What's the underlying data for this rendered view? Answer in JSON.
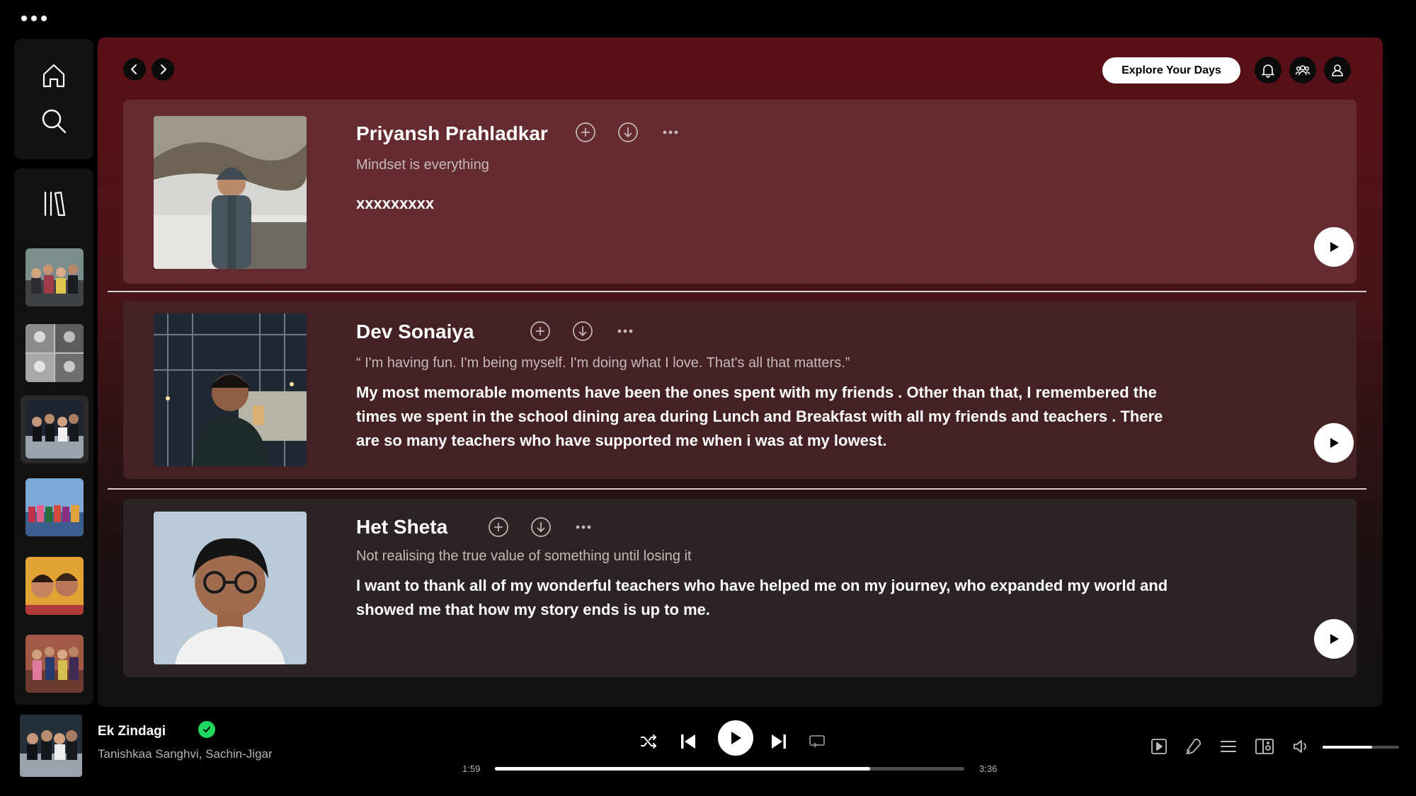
{
  "app": {
    "menu_icon": "ellipsis-icon"
  },
  "sidebar": {
    "nav": [
      {
        "name": "home",
        "icon": "home-icon"
      },
      {
        "name": "search",
        "icon": "search-icon"
      }
    ],
    "library_icon": "library-icon",
    "playlists": [
      {
        "name": "playlist-1"
      },
      {
        "name": "playlist-2"
      },
      {
        "name": "playlist-3",
        "active": true
      },
      {
        "name": "playlist-4"
      },
      {
        "name": "playlist-5"
      },
      {
        "name": "playlist-6"
      }
    ]
  },
  "header": {
    "back_icon": "chevron-left-icon",
    "forward_icon": "chevron-right-icon",
    "explore_label": "Explore Your Days",
    "icons": [
      "bell-icon",
      "friends-icon",
      "user-icon"
    ]
  },
  "cards": [
    {
      "name": "Priyansh Prahladkar",
      "tagline": "Mindset is everything",
      "body": "xxxxxxxxx"
    },
    {
      "name": "Dev Sonaiya",
      "tagline": "“ I'm having fun. I'm being myself. I'm doing what I love. That's all that matters.”",
      "body": "My most memorable moments have been the ones spent with my friends . Other than that, I remembered the times we spent in the school dining area during Lunch and Breakfast with all my friends and teachers . There are so many teachers who have supported me when i was at my lowest."
    },
    {
      "name": "Het Sheta",
      "tagline": "Not realising the true value of something until losing it",
      "body": "I want to thank all of my wonderful teachers who have helped me on my journey, who expanded my world and showed me that how my story ends is up to me."
    }
  ],
  "player": {
    "track_title": "Ek Zindagi",
    "artists": "Tanishkaa Sanghvi, Sachin-Jigar",
    "elapsed": "1:59",
    "duration": "3:36",
    "progress": 0.8,
    "volume": 0.65,
    "liked": true
  },
  "colors": {
    "accent_green": "#1ed760",
    "header_red": "#5a1016",
    "card_bg": "#3a1b1e"
  }
}
